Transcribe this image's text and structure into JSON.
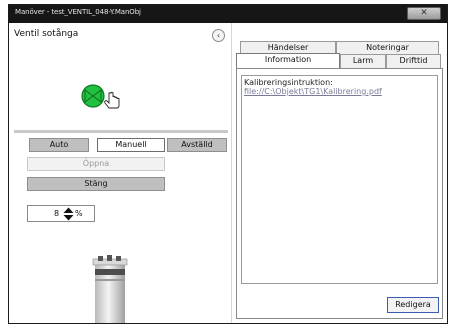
{
  "window": {
    "title": "Manöver - test_VENTIL_048-Y.ManObj",
    "close_glyph": "✕"
  },
  "left": {
    "object_title": "Ventil sotånga",
    "collapse_glyph": "‹",
    "valve_icon": "valve-open-icon",
    "valve_color": "#20c040",
    "mode_buttons": {
      "auto": "Auto",
      "manual": "Manuell",
      "disabled": "Avställd"
    },
    "open_label": "Öppna",
    "close_label": "Stäng",
    "setpoint": {
      "value": "8",
      "unit": "%"
    }
  },
  "tabs": {
    "row_top": [
      "Händelser",
      "Noteringar"
    ],
    "row_bottom": [
      "Information",
      "Larm",
      "Drifttid"
    ],
    "active": "Information"
  },
  "info": {
    "label": "Kalibreringsintruktion:",
    "link": "file://C:\\Objekt\\TG1\\Kalibrering.pdf"
  },
  "edit_label": "Redigera"
}
